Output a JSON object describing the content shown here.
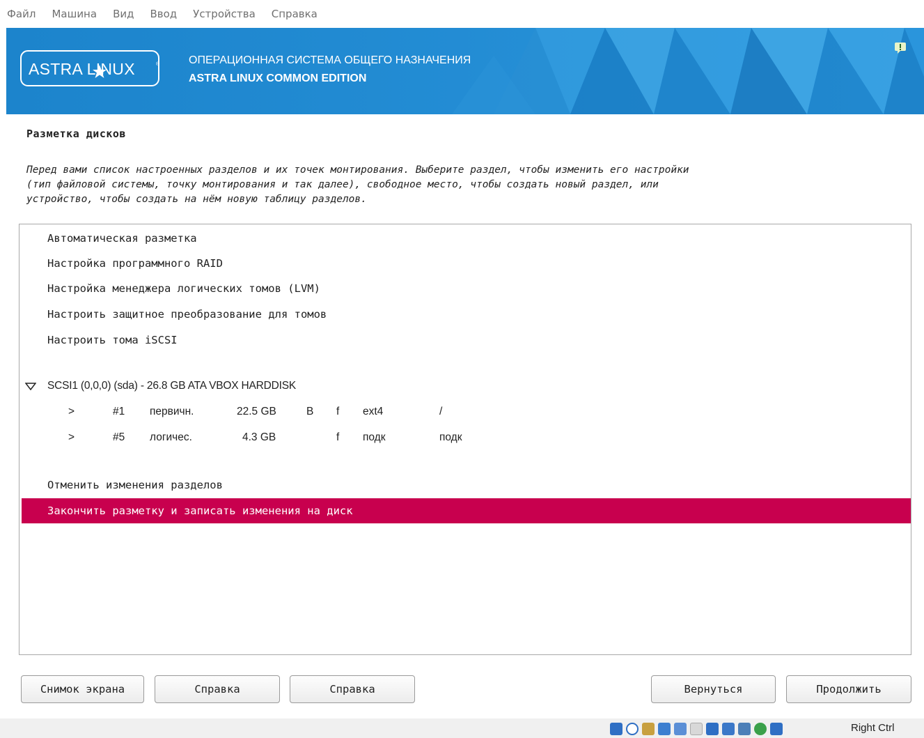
{
  "menu": [
    "Файл",
    "Машина",
    "Вид",
    "Ввод",
    "Устройства",
    "Справка"
  ],
  "banner": {
    "logo_text": "ASTRA LINUX",
    "logo_reg": "®",
    "line1": "ОПЕРАЦИОННАЯ СИСТЕМА ОБЩЕГО НАЗНАЧЕНИЯ",
    "line2": "ASTRA LINUX COMMON EDITION",
    "bg_color": "#1f8ad2"
  },
  "page": {
    "title": "Разметка дисков",
    "description": [
      "Перед вами список настроенных разделов и их точек монтирования. Выберите раздел, чтобы изменить его настройки",
      "(тип файловой системы, точку монтирования и так далее), свободное место, чтобы создать новый раздел, или",
      "устройство, чтобы создать на нём новую таблицу разделов."
    ]
  },
  "list": {
    "top_items": [
      "Автоматическая разметка",
      "Настройка программного RAID",
      "Настройка менеджера логических томов (LVM)",
      "Настроить защитное преобразование для томов",
      "Настроить тома iSCSI"
    ],
    "disk": "SCSI1 (0,0,0) (sda) - 26.8 GB ATA VBOX HARDDISK",
    "partitions": [
      {
        "arrow": ">",
        "num": "#1",
        "type": "первичн.",
        "size": "22.5 GB",
        "boot": "B",
        "format": "f",
        "fs": "ext4",
        "mount": "/"
      },
      {
        "arrow": ">",
        "num": "#5",
        "type": "логичес.",
        "size": "4.3 GB",
        "boot": "",
        "format": "f",
        "fs": "подк",
        "mount": "подк"
      }
    ],
    "undo": "Отменить изменения разделов",
    "finish": "Закончить разметку и записать изменения на диск",
    "selected_color": "#c8004e"
  },
  "buttons": {
    "screenshot": "Снимок экрана",
    "help1": "Справка",
    "help2": "Справка",
    "back": "Вернуться",
    "continue": "Продолжить"
  },
  "statusbar": {
    "host_key": "Right Ctrl",
    "icons": [
      "hdd-icon",
      "optical-disk-icon",
      "audio-icon",
      "network-icon",
      "usb-icon",
      "shared-folder-icon",
      "display-icon",
      "recording-icon",
      "cpu-icon",
      "vm-state-icon",
      "mouse-integration-icon"
    ]
  }
}
